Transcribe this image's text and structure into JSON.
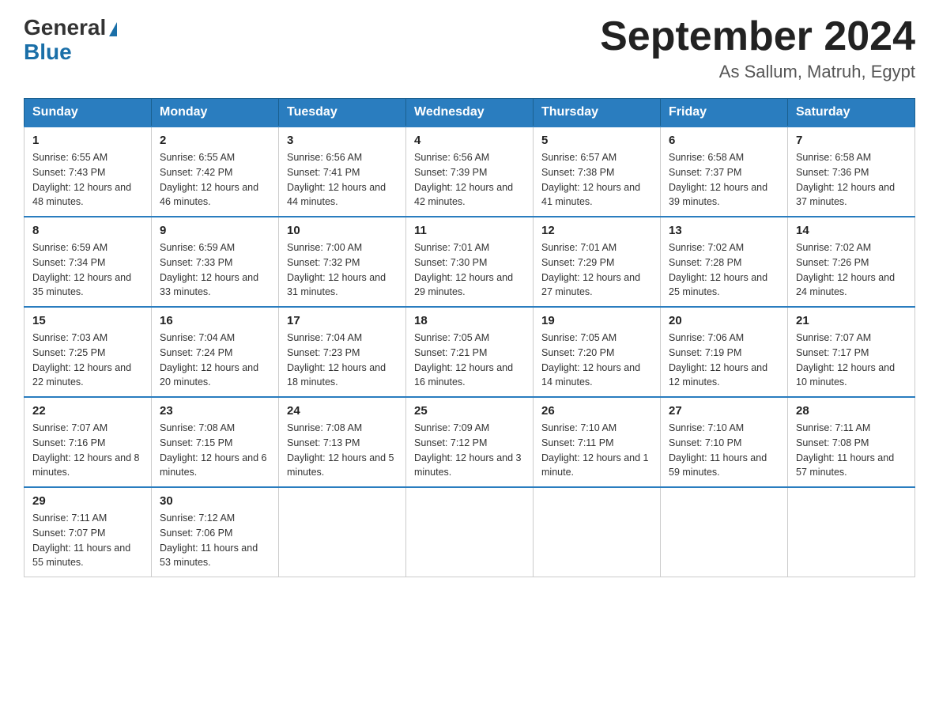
{
  "header": {
    "logo_general": "General",
    "logo_blue": "Blue",
    "month_year": "September 2024",
    "location": "As Sallum, Matruh, Egypt"
  },
  "days_of_week": [
    "Sunday",
    "Monday",
    "Tuesday",
    "Wednesday",
    "Thursday",
    "Friday",
    "Saturday"
  ],
  "weeks": [
    [
      {
        "day": 1,
        "sunrise": "6:55 AM",
        "sunset": "7:43 PM",
        "daylight": "12 hours and 48 minutes."
      },
      {
        "day": 2,
        "sunrise": "6:55 AM",
        "sunset": "7:42 PM",
        "daylight": "12 hours and 46 minutes."
      },
      {
        "day": 3,
        "sunrise": "6:56 AM",
        "sunset": "7:41 PM",
        "daylight": "12 hours and 44 minutes."
      },
      {
        "day": 4,
        "sunrise": "6:56 AM",
        "sunset": "7:39 PM",
        "daylight": "12 hours and 42 minutes."
      },
      {
        "day": 5,
        "sunrise": "6:57 AM",
        "sunset": "7:38 PM",
        "daylight": "12 hours and 41 minutes."
      },
      {
        "day": 6,
        "sunrise": "6:58 AM",
        "sunset": "7:37 PM",
        "daylight": "12 hours and 39 minutes."
      },
      {
        "day": 7,
        "sunrise": "6:58 AM",
        "sunset": "7:36 PM",
        "daylight": "12 hours and 37 minutes."
      }
    ],
    [
      {
        "day": 8,
        "sunrise": "6:59 AM",
        "sunset": "7:34 PM",
        "daylight": "12 hours and 35 minutes."
      },
      {
        "day": 9,
        "sunrise": "6:59 AM",
        "sunset": "7:33 PM",
        "daylight": "12 hours and 33 minutes."
      },
      {
        "day": 10,
        "sunrise": "7:00 AM",
        "sunset": "7:32 PM",
        "daylight": "12 hours and 31 minutes."
      },
      {
        "day": 11,
        "sunrise": "7:01 AM",
        "sunset": "7:30 PM",
        "daylight": "12 hours and 29 minutes."
      },
      {
        "day": 12,
        "sunrise": "7:01 AM",
        "sunset": "7:29 PM",
        "daylight": "12 hours and 27 minutes."
      },
      {
        "day": 13,
        "sunrise": "7:02 AM",
        "sunset": "7:28 PM",
        "daylight": "12 hours and 25 minutes."
      },
      {
        "day": 14,
        "sunrise": "7:02 AM",
        "sunset": "7:26 PM",
        "daylight": "12 hours and 24 minutes."
      }
    ],
    [
      {
        "day": 15,
        "sunrise": "7:03 AM",
        "sunset": "7:25 PM",
        "daylight": "12 hours and 22 minutes."
      },
      {
        "day": 16,
        "sunrise": "7:04 AM",
        "sunset": "7:24 PM",
        "daylight": "12 hours and 20 minutes."
      },
      {
        "day": 17,
        "sunrise": "7:04 AM",
        "sunset": "7:23 PM",
        "daylight": "12 hours and 18 minutes."
      },
      {
        "day": 18,
        "sunrise": "7:05 AM",
        "sunset": "7:21 PM",
        "daylight": "12 hours and 16 minutes."
      },
      {
        "day": 19,
        "sunrise": "7:05 AM",
        "sunset": "7:20 PM",
        "daylight": "12 hours and 14 minutes."
      },
      {
        "day": 20,
        "sunrise": "7:06 AM",
        "sunset": "7:19 PM",
        "daylight": "12 hours and 12 minutes."
      },
      {
        "day": 21,
        "sunrise": "7:07 AM",
        "sunset": "7:17 PM",
        "daylight": "12 hours and 10 minutes."
      }
    ],
    [
      {
        "day": 22,
        "sunrise": "7:07 AM",
        "sunset": "7:16 PM",
        "daylight": "12 hours and 8 minutes."
      },
      {
        "day": 23,
        "sunrise": "7:08 AM",
        "sunset": "7:15 PM",
        "daylight": "12 hours and 6 minutes."
      },
      {
        "day": 24,
        "sunrise": "7:08 AM",
        "sunset": "7:13 PM",
        "daylight": "12 hours and 5 minutes."
      },
      {
        "day": 25,
        "sunrise": "7:09 AM",
        "sunset": "7:12 PM",
        "daylight": "12 hours and 3 minutes."
      },
      {
        "day": 26,
        "sunrise": "7:10 AM",
        "sunset": "7:11 PM",
        "daylight": "12 hours and 1 minute."
      },
      {
        "day": 27,
        "sunrise": "7:10 AM",
        "sunset": "7:10 PM",
        "daylight": "11 hours and 59 minutes."
      },
      {
        "day": 28,
        "sunrise": "7:11 AM",
        "sunset": "7:08 PM",
        "daylight": "11 hours and 57 minutes."
      }
    ],
    [
      {
        "day": 29,
        "sunrise": "7:11 AM",
        "sunset": "7:07 PM",
        "daylight": "11 hours and 55 minutes."
      },
      {
        "day": 30,
        "sunrise": "7:12 AM",
        "sunset": "7:06 PM",
        "daylight": "11 hours and 53 minutes."
      },
      null,
      null,
      null,
      null,
      null
    ]
  ]
}
